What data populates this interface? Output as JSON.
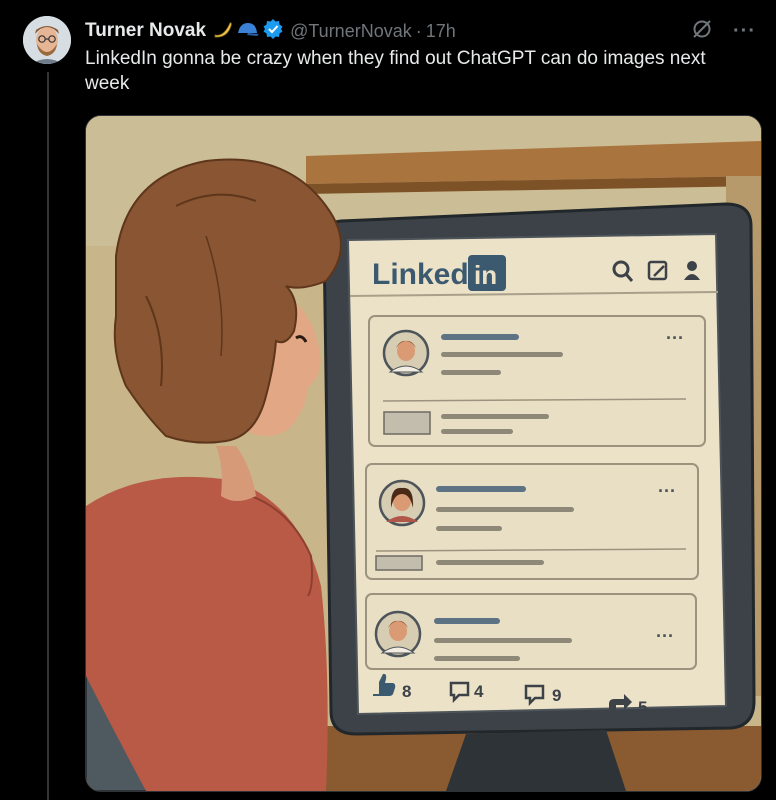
{
  "tweet": {
    "author_name": "Turner Novak",
    "handle": "@TurnerNovak",
    "separator": "·",
    "time": "17h",
    "text": "LinkedIn gonna be crazy when they find out ChatGPT can do images next week",
    "more_label": "···",
    "badges": [
      "banana-icon",
      "cap-icon",
      "verified-icon"
    ],
    "colors": {
      "verified": "#1d9bf0",
      "muted": "#71767b",
      "text": "#e7e9ea"
    }
  },
  "image": {
    "logo_text": "Linked",
    "logo_box": "in",
    "post_menu": "···",
    "reactions": {
      "likes": "8",
      "comments": "4",
      "shares": "9",
      "reposts": "5"
    },
    "colors": {
      "logo": "#3b5a70",
      "paper": "#ece2c8",
      "frame": "#3c4248"
    }
  }
}
